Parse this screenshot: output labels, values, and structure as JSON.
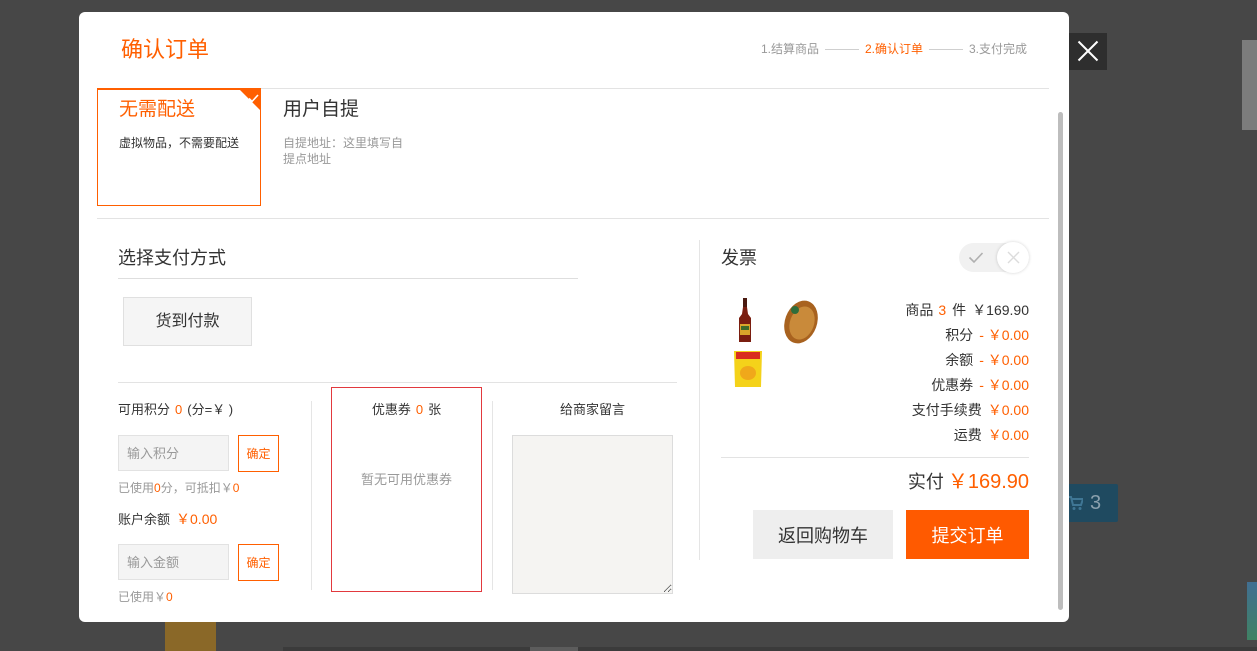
{
  "colors": {
    "accent": "#ff5f00",
    "primary_button": "#ff5a00",
    "coupon_border": "#e2393e"
  },
  "icons": {
    "close": "close-icon",
    "selected_corner": "check-icon",
    "toggle_on": "check-icon",
    "toggle_off": "close-icon",
    "products": [
      "bottle-image",
      "coconut-image",
      "snack-bag-image"
    ],
    "background_cart": "cart-icon"
  },
  "modal": {
    "title": "确认订单"
  },
  "steps": [
    {
      "label": "1.结算商品",
      "active": false
    },
    {
      "label": "2.确认订单",
      "active": true
    },
    {
      "label": "3.支付完成",
      "active": false
    }
  ],
  "delivery": [
    {
      "title": "无需配送",
      "desc": "虚拟物品，不需要配送",
      "selected": true
    },
    {
      "title": "用户自提",
      "desc": "自提地址：这里填写自提点地址",
      "selected": false
    }
  ],
  "payment": {
    "heading": "选择支付方式",
    "methods": [
      {
        "label": "货到付款"
      }
    ]
  },
  "points": {
    "label": "可用积分",
    "available": "0",
    "rate_text": "(分=￥ )",
    "input_placeholder": "输入积分",
    "confirm_label": "确定",
    "used_prefix": "已使用",
    "used_points": "0",
    "used_mid": "分，可抵扣￥",
    "used_amount": "0"
  },
  "balance": {
    "label": "账户余额",
    "amount": "￥0.00",
    "input_placeholder": "输入金额",
    "confirm_label": "确定",
    "used_prefix": "已使用￥",
    "used_amount": "0"
  },
  "coupon": {
    "label": "优惠券",
    "count": "0",
    "unit": "张",
    "empty_text": "暂无可用优惠券"
  },
  "message": {
    "label": "给商家留言"
  },
  "invoice": {
    "label": "发票",
    "enabled": false
  },
  "summary": {
    "goods": {
      "label": "商品",
      "count": "3",
      "unit": "件",
      "amount": "￥169.90"
    },
    "rows": [
      {
        "label": "积分",
        "amount": "- ￥0.00"
      },
      {
        "label": "余额",
        "amount": "- ￥0.00"
      },
      {
        "label": "优惠券",
        "amount": "- ￥0.00"
      },
      {
        "label": "支付手续费",
        "amount": "￥0.00"
      },
      {
        "label": "运费",
        "amount": "￥0.00"
      }
    ],
    "total_label": "实付",
    "total_amount": "￥169.90"
  },
  "actions": {
    "back_label": "返回购物车",
    "submit_label": "提交订单"
  },
  "background": {
    "cart_count": "3"
  }
}
